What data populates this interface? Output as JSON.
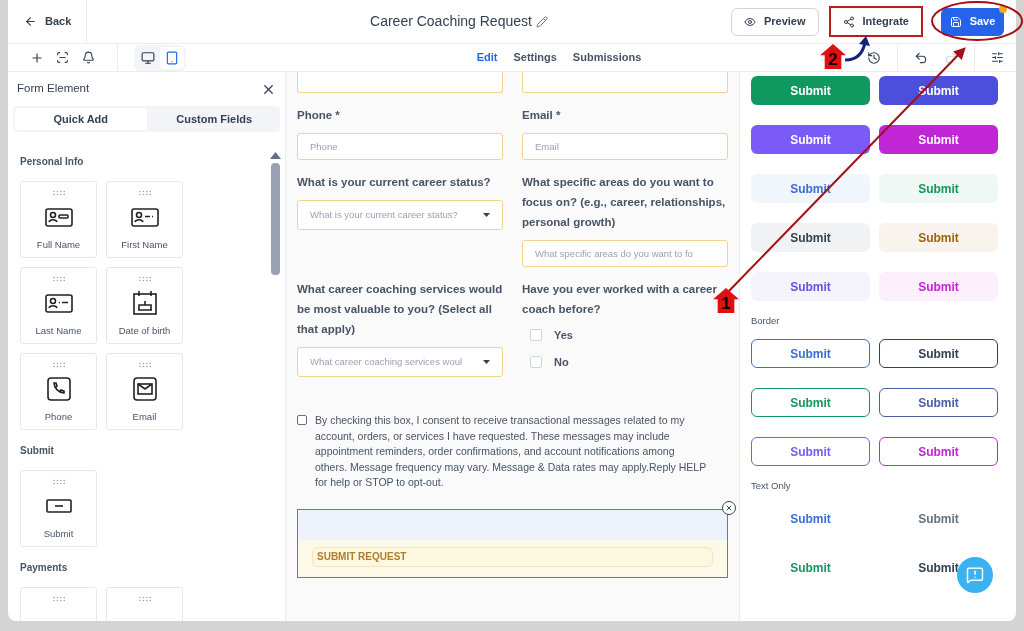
{
  "header": {
    "back": "Back",
    "title": "Career Coaching Request",
    "preview": "Preview",
    "integrate": "Integrate",
    "save": "Save",
    "save_notification": true
  },
  "toolbar": {
    "devices": [
      {
        "kind": "desktop",
        "selected": false
      },
      {
        "kind": "tablet",
        "selected": true
      }
    ],
    "tabs": [
      {
        "label": "Edit",
        "selected": true
      },
      {
        "label": "Settings",
        "selected": false
      },
      {
        "label": "Submissions",
        "selected": false
      }
    ],
    "redo_disabled": true
  },
  "sidebar": {
    "title": "Form Element",
    "tabs": [
      {
        "label": "Quick Add",
        "selected": true
      },
      {
        "label": "Custom Fields",
        "selected": false
      }
    ],
    "sections": [
      {
        "title": "Personal Info",
        "items": [
          {
            "label": "Full Name",
            "kind": "card-full"
          },
          {
            "label": "First Name",
            "kind": "card-first"
          },
          {
            "label": "Last Name",
            "kind": "card-last"
          },
          {
            "label": "Date of birth",
            "kind": "cake"
          },
          {
            "label": "Phone",
            "kind": "phone"
          },
          {
            "label": "Email",
            "kind": "mail"
          }
        ]
      },
      {
        "title": "Submit",
        "items": [
          {
            "label": "Submit",
            "kind": "submit"
          }
        ]
      },
      {
        "title": "Payments",
        "items": [
          {
            "kind": "hidden"
          },
          {
            "kind": "hidden"
          }
        ]
      }
    ]
  },
  "form": {
    "rows": [
      [
        {
          "kind": "cut"
        },
        {
          "kind": "cut"
        }
      ],
      [
        {
          "label": "Phone *",
          "kind": "text",
          "placeholder": "Phone"
        },
        {
          "label": "Email *",
          "kind": "text",
          "placeholder": "Email"
        }
      ],
      [
        {
          "label": "What is your current career status?",
          "kind": "select",
          "placeholder": "What is your current career status?"
        },
        {
          "label": "What specific areas do you want to focus on? (e.g., career, relationships, personal growth)",
          "kind": "text",
          "placeholder": "What specific areas do you want to fo"
        }
      ],
      [
        {
          "label": "What career coaching services would be most valuable to you? (Select all that apply)",
          "kind": "select",
          "placeholder": "What career coaching services woul"
        },
        {
          "label": "Have you ever worked with a career coach before?",
          "kind": "checkboxes",
          "options": [
            {
              "label": "Yes",
              "checked": false
            },
            {
              "label": "No",
              "checked": false
            }
          ]
        }
      ]
    ],
    "consent": {
      "text": "By checking this box, I consent to receive transactional messages related to my account, orders, or services I have requested. These messages may include appointment reminders, order confirmations, and account notifications among others. Message frequency may vary. Message & Data rates may apply.Reply HELP for help or STOP to opt-out.",
      "checked": false
    },
    "submit": {
      "label": "SUBMIT REQUEST",
      "selected": true
    }
  },
  "palette": [
    {
      "buttons": [
        {
          "label": "Submit",
          "kind": "solid",
          "color": "#0f9960"
        },
        {
          "label": "Submit",
          "kind": "solid",
          "color": "#4c4fdc"
        },
        {
          "label": "Submit",
          "kind": "solid",
          "color": "#7a5af8"
        },
        {
          "label": "Submit",
          "kind": "solid",
          "color": "#c026d3"
        },
        {
          "label": "Submit",
          "kind": "soft",
          "color": "#3b6fd6"
        },
        {
          "label": "Submit",
          "kind": "soft",
          "color": "#16965f"
        },
        {
          "label": "Submit",
          "kind": "soft",
          "color": "#344054"
        },
        {
          "label": "Submit",
          "kind": "soft",
          "color": "#a16207"
        },
        {
          "label": "Submit",
          "kind": "soft",
          "color": "#6d4fd6"
        },
        {
          "label": "Submit",
          "kind": "soft",
          "color": "#c026d3"
        }
      ]
    },
    {
      "title": "Border",
      "buttons": [
        {
          "label": "Submit",
          "kind": "border",
          "color": "#3b6fd6"
        },
        {
          "label": "Submit",
          "kind": "border",
          "color": "#344054"
        },
        {
          "label": "Submit",
          "kind": "border",
          "color": "#16965f"
        },
        {
          "label": "Submit",
          "kind": "border",
          "color": "#4e5ba6"
        },
        {
          "label": "Submit",
          "kind": "border",
          "color": "#7a5af8"
        },
        {
          "label": "Submit",
          "kind": "border",
          "color": "#c026d3"
        }
      ]
    },
    {
      "title": "Text Only",
      "buttons": [
        {
          "label": "Submit",
          "kind": "text",
          "color": "#3b6fd6"
        },
        {
          "label": "Submit",
          "kind": "text",
          "color": "#667085"
        },
        {
          "label": "Submit",
          "kind": "text",
          "color": "#16965f"
        },
        {
          "label": "Submit",
          "kind": "text",
          "color": "#344054"
        }
      ]
    }
  ],
  "annotations": [
    {
      "number": "1"
    },
    {
      "number": "2"
    }
  ]
}
